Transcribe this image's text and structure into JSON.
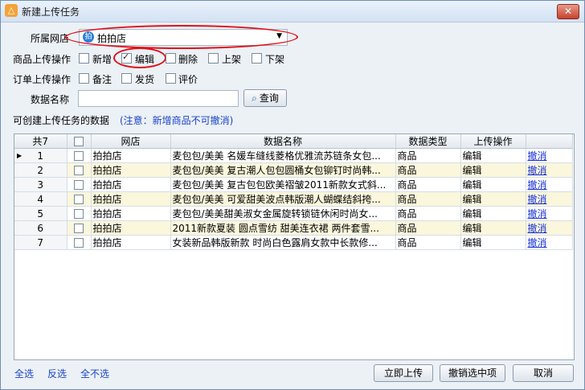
{
  "window": {
    "title": "新建上传任务",
    "close_label": "✕"
  },
  "shop": {
    "label": "所属网店",
    "value": "拍拍店",
    "icon": "shop-icon"
  },
  "product_ops": {
    "label": "商品上传操作",
    "options": [
      "新增",
      "编辑",
      "删除",
      "上架",
      "下架"
    ],
    "checked": [
      "编辑"
    ]
  },
  "order_ops": {
    "label": "订单上传操作",
    "options": [
      "备注",
      "发货",
      "评价"
    ]
  },
  "data_name": {
    "label": "数据名称",
    "value": "",
    "query_label": "查询"
  },
  "list_header": {
    "label": "可创建上传任务的数据",
    "note": "(注意：新增商品不可撤消)"
  },
  "table": {
    "count_label": "共7",
    "columns": [
      "网店",
      "数据名称",
      "数据类型",
      "上传操作"
    ],
    "rows": [
      {
        "no": "1",
        "shop": "拍拍店",
        "name": "麦包包/美美 名媛车缝线菱格优雅流苏链条女包...",
        "type": "商品",
        "op": "编辑",
        "action": "撤消"
      },
      {
        "no": "2",
        "shop": "拍拍店",
        "name": "麦包包/美美 复古潮人包包圆桶女包铆钉时尚韩...",
        "type": "商品",
        "op": "编辑",
        "action": "撤消"
      },
      {
        "no": "3",
        "shop": "拍拍店",
        "name": "麦包包/美美 复古包包欧美褶皱2011新款女式斜...",
        "type": "商品",
        "op": "编辑",
        "action": "撤消"
      },
      {
        "no": "4",
        "shop": "拍拍店",
        "name": "麦包包/美美 可爱甜美波点韩版潮人蝴蝶结斜挎...",
        "type": "商品",
        "op": "编辑",
        "action": "撤消"
      },
      {
        "no": "5",
        "shop": "拍拍店",
        "name": "麦包包/美美甜美淑女金属旋转锁链休闲时尚女...",
        "type": "商品",
        "op": "编辑",
        "action": "撤消"
      },
      {
        "no": "6",
        "shop": "拍拍店",
        "name": "2011新款夏装 圆点雪纺 甜美连衣裙 两件套雪...",
        "type": "商品",
        "op": "编辑",
        "action": "撤消"
      },
      {
        "no": "7",
        "shop": "拍拍店",
        "name": "女装新品韩版新款 时尚白色露肩女款中长款修...",
        "type": "商品",
        "op": "编辑",
        "action": "撤消"
      }
    ]
  },
  "footer": {
    "select_all": "全选",
    "invert": "反选",
    "select_none": "全不选",
    "upload": "立即上传",
    "cancel_selected": "撤销选中项",
    "cancel": "取消"
  },
  "colors": {
    "annotation": "#e0101a",
    "link": "#1a33d6",
    "alt_row": "#fbf7dc"
  }
}
